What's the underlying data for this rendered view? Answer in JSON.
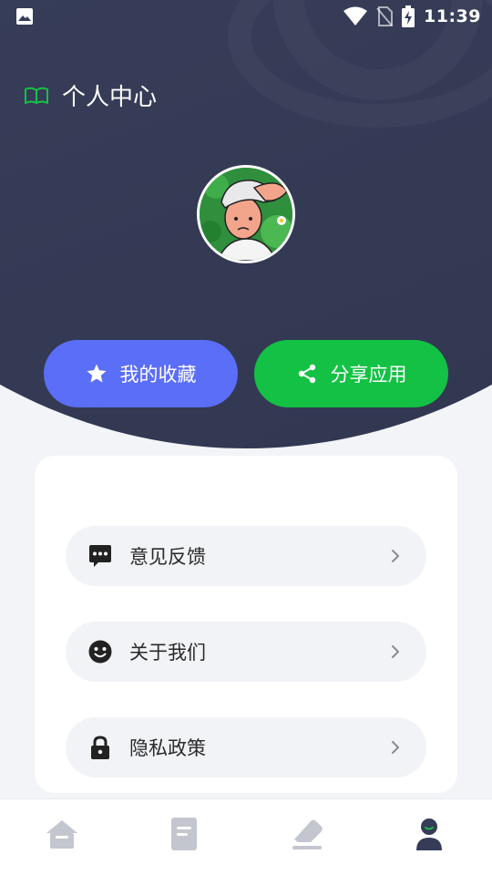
{
  "status_bar": {
    "time": "11:39",
    "icons": [
      "image-icon",
      "wifi-icon",
      "no-sim-icon",
      "battery-charging-icon"
    ]
  },
  "header": {
    "title": "个人中心",
    "title_icon": "book-icon",
    "avatar": "avatar"
  },
  "actions": {
    "favorites_label": "我的收藏",
    "favorites_icon": "star-icon",
    "share_label": "分享应用",
    "share_icon": "share-icon"
  },
  "menu": {
    "items": [
      {
        "label": "意见反馈",
        "icon": "message-icon"
      },
      {
        "label": "关于我们",
        "icon": "smile-icon"
      },
      {
        "label": "隐私政策",
        "icon": "lock-icon"
      }
    ]
  },
  "tab_bar": {
    "tabs": [
      "home-icon",
      "document-icon",
      "eraser-icon",
      "profile-icon"
    ],
    "active": "profile-icon"
  },
  "colors": {
    "header_bg": "#363c57",
    "favorites_button": "#5b6ef7",
    "share_button": "#13c244",
    "accent_green": "#13c244",
    "menu_item_bg": "#f2f3f7",
    "tab_inactive": "#c4c6cf",
    "tab_active": "#363c57"
  }
}
